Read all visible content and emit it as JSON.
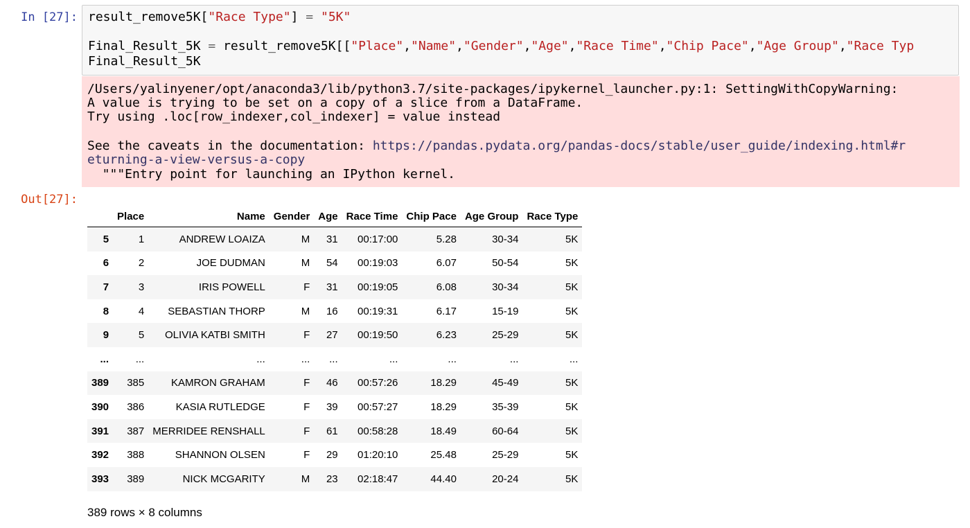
{
  "input_prompt": "In [27]:",
  "output_prompt": "Out[27]:",
  "code": {
    "line1": {
      "a": "result_remove5K[",
      "b": "\"Race Type\"",
      "c": "] ",
      "d": "=",
      "e": " ",
      "f": "\"5K\""
    },
    "line2": {
      "a": "Final_Result_5K ",
      "b": "=",
      "c": " result_remove5K[[",
      "s1": "\"Place\"",
      "s2": "\"Name\"",
      "s3": "\"Gender\"",
      "s4": "\"Age\"",
      "s5": "\"Race Time\"",
      "s6": "\"Chip Pace\"",
      "s7": "\"Age Group\"",
      "s8": "\"Race Typ",
      "comma": ","
    },
    "line3": "Final_Result_5K"
  },
  "stderr": {
    "line1": "/Users/yalinyener/opt/anaconda3/lib/python3.7/site-packages/ipykernel_launcher.py:1: SettingWithCopyWarning:",
    "line2": "A value is trying to be set on a copy of a slice from a DataFrame.",
    "line3": "Try using .loc[row_indexer,col_indexer] = value instead",
    "line4_prefix": "See the caveats in the documentation: ",
    "line4_link": "https://pandas.pydata.org/pandas-docs/stable/user_guide/indexing.html#r",
    "line5_link": "eturning-a-view-versus-a-copy",
    "line6": "  \"\"\"Entry point for launching an IPython kernel."
  },
  "table": {
    "columns": [
      "",
      "Place",
      "Name",
      "Gender",
      "Age",
      "Race Time",
      "Chip Pace",
      "Age Group",
      "Race Type"
    ],
    "rows": [
      [
        "5",
        "1",
        "ANDREW LOAIZA",
        "M",
        "31",
        "00:17:00",
        "5.28",
        "30-34",
        "5K"
      ],
      [
        "6",
        "2",
        "JOE DUDMAN",
        "M",
        "54",
        "00:19:03",
        "6.07",
        "50-54",
        "5K"
      ],
      [
        "7",
        "3",
        "IRIS POWELL",
        "F",
        "31",
        "00:19:05",
        "6.08",
        "30-34",
        "5K"
      ],
      [
        "8",
        "4",
        "SEBASTIAN THORP",
        "M",
        "16",
        "00:19:31",
        "6.17",
        "15-19",
        "5K"
      ],
      [
        "9",
        "5",
        "OLIVIA KATBI SMITH",
        "F",
        "27",
        "00:19:50",
        "6.23",
        "25-29",
        "5K"
      ],
      [
        "...",
        "...",
        "...",
        "...",
        "...",
        "...",
        "...",
        "...",
        "..."
      ],
      [
        "389",
        "385",
        "KAMRON GRAHAM",
        "F",
        "46",
        "00:57:26",
        "18.29",
        "45-49",
        "5K"
      ],
      [
        "390",
        "386",
        "KASIA RUTLEDGE",
        "F",
        "39",
        "00:57:27",
        "18.29",
        "35-39",
        "5K"
      ],
      [
        "391",
        "387",
        "MERRIDEE RENSHALL",
        "F",
        "61",
        "00:58:28",
        "18.49",
        "60-64",
        "5K"
      ],
      [
        "392",
        "388",
        "SHANNON OLSEN",
        "F",
        "29",
        "01:20:10",
        "25.48",
        "25-29",
        "5K"
      ],
      [
        "393",
        "389",
        "NICK MCGARITY",
        "M",
        "23",
        "02:18:47",
        "44.40",
        "20-24",
        "5K"
      ]
    ]
  },
  "shape_text": "389 rows × 8 columns"
}
